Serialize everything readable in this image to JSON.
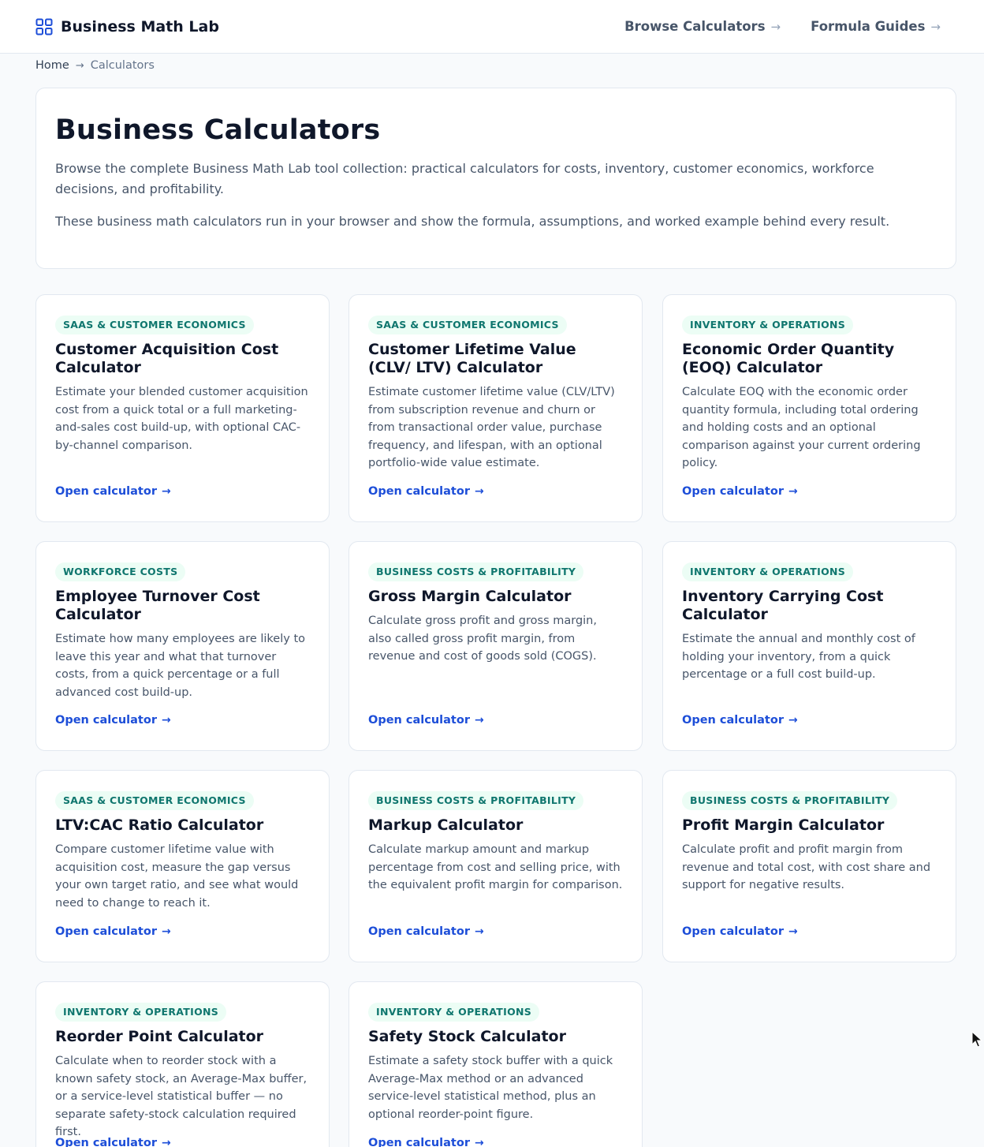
{
  "header": {
    "brand": "Business Math Lab",
    "nav": [
      {
        "label": "Browse Calculators",
        "arrow": "→"
      },
      {
        "label": "Formula Guides",
        "arrow": "→"
      }
    ]
  },
  "breadcrumb": {
    "home": "Home",
    "separator": "→",
    "current": "Calculators"
  },
  "hero": {
    "title": "Business Calculators",
    "intro": "Browse the complete Business Math Lab tool collection: practical calculators for costs, inventory, customer economics, workforce decisions, and profitability.",
    "note": "These business math calculators run in your browser and show the formula, assumptions, and worked example behind every result."
  },
  "colors": {
    "accent": "#1d4ed8",
    "badge_bg": "#ecfdf5",
    "badge_text": "#0f766e"
  },
  "cards": [
    {
      "category": "SAAS & CUSTOMER ECONOMICS",
      "title": "Customer Acquisition Cost Calculator",
      "description": "Estimate your blended customer acquisition cost from a quick total or a full marketing-and-sales cost build-up, with optional CAC-by-channel comparison.",
      "link": "Open calculator",
      "arrow": "→"
    },
    {
      "category": "SAAS & CUSTOMER ECONOMICS",
      "title": "Customer Lifetime Value (CLV/ LTV) Calculator",
      "description": "Estimate customer lifetime value (CLV/LTV) from subscription revenue and churn or from transactional order value, purchase frequency, and lifespan, with an optional portfolio-wide value estimate.",
      "link": "Open calculator",
      "arrow": "→"
    },
    {
      "category": "INVENTORY & OPERATIONS",
      "title": "Economic Order Quantity (EOQ) Calculator",
      "description": "Calculate EOQ with the economic order quantity formula, including total ordering and holding costs and an optional comparison against your current ordering policy.",
      "link": "Open calculator",
      "arrow": "→"
    },
    {
      "category": "WORKFORCE COSTS",
      "title": "Employee Turnover Cost Calculator",
      "description": "Estimate how many employees are likely to leave this year and what that turnover costs, from a quick percentage or a full advanced cost build-up.",
      "link": "Open calculator",
      "arrow": "→"
    },
    {
      "category": "BUSINESS COSTS & PROFITABILITY",
      "title": "Gross Margin Calculator",
      "description": "Calculate gross profit and gross margin, also called gross profit margin, from revenue and cost of goods sold (COGS).",
      "link": "Open calculator",
      "arrow": "→"
    },
    {
      "category": "INVENTORY & OPERATIONS",
      "title": "Inventory Carrying Cost Calculator",
      "description": "Estimate the annual and monthly cost of holding your inventory, from a quick percentage or a full cost build-up.",
      "link": "Open calculator",
      "arrow": "→"
    },
    {
      "category": "SAAS & CUSTOMER ECONOMICS",
      "title": "LTV:CAC Ratio Calculator",
      "description": "Compare customer lifetime value with acquisition cost, measure the gap versus your own target ratio, and see what would need to change to reach it.",
      "link": "Open calculator",
      "arrow": "→"
    },
    {
      "category": "BUSINESS COSTS & PROFITABILITY",
      "title": "Markup Calculator",
      "description": "Calculate markup amount and markup percentage from cost and selling price, with the equivalent profit margin for comparison.",
      "link": "Open calculator",
      "arrow": "→"
    },
    {
      "category": "BUSINESS COSTS & PROFITABILITY",
      "title": "Profit Margin Calculator",
      "description": "Calculate profit and profit margin from revenue and total cost, with cost share and support for negative results.",
      "link": "Open calculator",
      "arrow": "→"
    },
    {
      "category": "INVENTORY & OPERATIONS",
      "title": "Reorder Point Calculator",
      "description": "Calculate when to reorder stock with a known safety stock, an Average-Max buffer, or a service-level statistical buffer — no separate safety-stock calculation required first.",
      "link": "Open calculator",
      "arrow": "→"
    },
    {
      "category": "INVENTORY & OPERATIONS",
      "title": "Safety Stock Calculator",
      "description": "Estimate a safety stock buffer with a quick Average-Max method or an advanced service-level statistical method, plus an optional reorder-point figure.",
      "link": "Open calculator",
      "arrow": "→"
    }
  ]
}
